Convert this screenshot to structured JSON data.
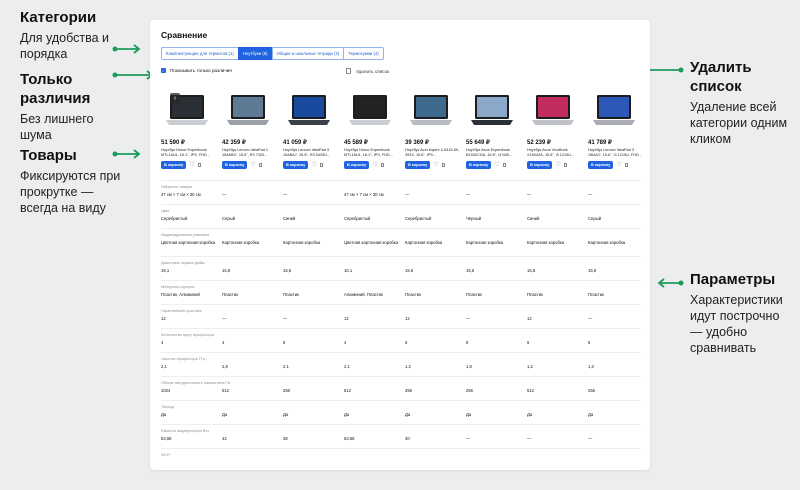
{
  "annotations": {
    "categories": {
      "title": "Категории",
      "text": "Для удобства и порядка"
    },
    "differences": {
      "title": "Только различия",
      "text": "Без лишнего шума"
    },
    "products": {
      "title": "Товары",
      "text": "Фиксируются при прокрутке — всегда на виду"
    },
    "delete": {
      "title": "Удалить список",
      "text": "Удаление всей категории одним кликом"
    },
    "params": {
      "title": "Параметры",
      "text": "Характеристики идут построчно — удобно сравнивать"
    }
  },
  "accent": "#1f63e0",
  "arrow_color": "#1d9b5b",
  "page": {
    "title": "Сравнение",
    "tabs": [
      {
        "label": "Комплектующие для термосов (1)",
        "active": false
      },
      {
        "label": "Ноутбуки (8)",
        "active": true
      },
      {
        "label": "Общие и школьные тетради (2)",
        "active": false
      },
      {
        "label": "Термосумки (4)",
        "active": false
      }
    ],
    "only_differences_label": "Показывать только различия",
    "delete_list_label": "Удалить список",
    "cart_label": "В корзину",
    "products": [
      {
        "price": "51 590 ₽",
        "name": "Ноутбук Honor Expertbook MTL16U1, 16.1\", IPS, FHD..."
      },
      {
        "price": "42 359 ₽",
        "name": "Ноутбук Lenovo IdeaPad 1 15AMN7, 15.6\", R3 7320..."
      },
      {
        "price": "41 059 ₽",
        "name": "Ноутбук Lenovo IdeaPad 3 15ABA7, 15.6\", R3 5425U..."
      },
      {
        "price": "45 589 ₽",
        "name": "Ноутбук Honor Expertbook MTL16U1, 16.1\", IPS, FHD..."
      },
      {
        "price": "39 369 ₽",
        "name": "Ноутбук Acer Aspire 3 A315-59-393X, 15.6\", IPS..."
      },
      {
        "price": "55 649 ₽",
        "name": "Ноутбук Asus Expertbook B1502CGA, 15.6\", i3 N30..."
      },
      {
        "price": "52 239 ₽",
        "name": "Ноутбук Asus VivoBook X1504ZA, 15.6\", i3 1215U..."
      },
      {
        "price": "41 789 ₽",
        "name": "Ноутбук Lenovo IdeaPad 3 15IAU7, 15.6\", i3 1215U, FHD..."
      }
    ],
    "params": [
      {
        "label": "Габариты товара",
        "values": [
          "47 см × 7 см × 30 см",
          "—",
          "—",
          "47 см × 7 см × 30 см",
          "—",
          "—",
          "—",
          "—"
        ]
      },
      {
        "label": "Цвет",
        "values": [
          "Серебристый",
          "Серый",
          "Синий",
          "Серебристый",
          "Серебристый",
          "Чёрный",
          "Синий",
          "Серый"
        ]
      },
      {
        "label": "Индивидуальная упаковка",
        "values": [
          "Цветная картонная коробка",
          "Картонная коробка",
          "Картонная коробка",
          "Цветная картонная коробка",
          "Картонная коробка",
          "Картонная коробка",
          "Картонная коробка",
          "Картонная коробка"
        ]
      },
      {
        "label": "Диагональ экрана дюйм",
        "values": [
          "16,1",
          "15,6",
          "15,6",
          "16,1",
          "15,6",
          "15,6",
          "15,6",
          "15,6"
        ]
      },
      {
        "label": "Материал корпуса",
        "values": [
          "Пластик, Алюминий",
          "Пластик",
          "Пластик",
          "Алюминий, Пластик",
          "Пластик",
          "Пластик",
          "Пластик",
          "Пластик"
        ]
      },
      {
        "label": "Гарантийный срок мес",
        "values": [
          "12",
          "—",
          "—",
          "12",
          "12",
          "—",
          "12",
          "—"
        ]
      },
      {
        "label": "Количество ядер процессора",
        "values": [
          "4",
          "4",
          "6",
          "4",
          "6",
          "8",
          "6",
          "6"
        ]
      },
      {
        "label": "Частота процессора ГГц",
        "values": [
          "2,1",
          "2,8",
          "2,1",
          "2,1",
          "1,2",
          "1,8",
          "1,2",
          "1,3"
        ]
      },
      {
        "label": "Объем твердотельного накопителя ГБ",
        "values": [
          "1024",
          "512",
          "256",
          "512",
          "256",
          "256",
          "512",
          "256"
        ]
      },
      {
        "label": "Тачпад",
        "values": [
          "Да",
          "Да",
          "Да",
          "Да",
          "Да",
          "Да",
          "Да",
          "Да"
        ]
      },
      {
        "label": "Емкость аккумулятора Втч",
        "values": [
          "53,58",
          "42",
          "38",
          "53,58",
          "40",
          "—",
          "—",
          "—"
        ]
      },
      {
        "label": "Wi-Fi",
        "values": [
          "",
          "",
          "",
          "",
          "",
          "",
          "",
          ""
        ]
      }
    ]
  }
}
